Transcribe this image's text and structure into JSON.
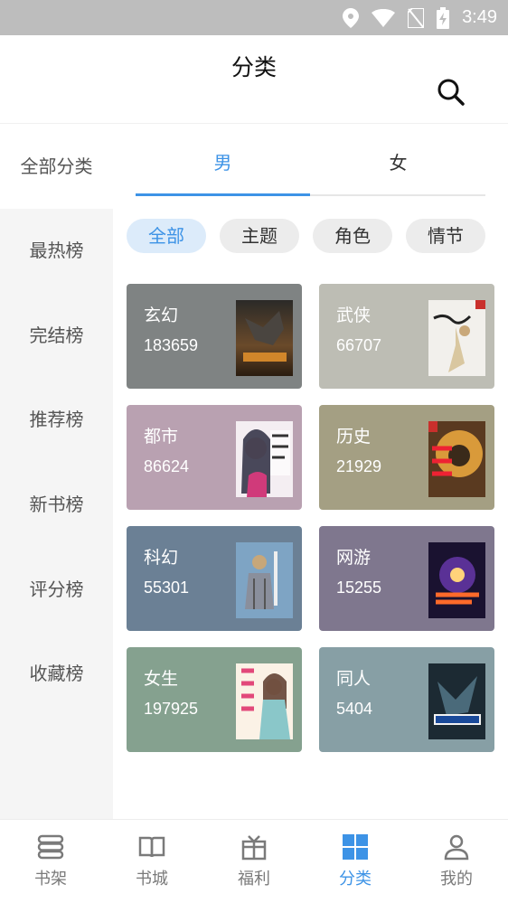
{
  "status_bar": {
    "time": "3:49"
  },
  "header": {
    "title": "分类",
    "search_icon": "search-icon"
  },
  "sidebar": {
    "items": [
      {
        "label": "全部分类",
        "selected": true
      },
      {
        "label": "最热榜"
      },
      {
        "label": "完结榜"
      },
      {
        "label": "推荐榜"
      },
      {
        "label": "新书榜"
      },
      {
        "label": "评分榜"
      },
      {
        "label": "收藏榜"
      }
    ]
  },
  "gender_tabs": [
    {
      "label": "男",
      "active": true
    },
    {
      "label": "女",
      "active": false
    }
  ],
  "filters": [
    {
      "label": "全部",
      "active": true
    },
    {
      "label": "主题"
    },
    {
      "label": "角色"
    },
    {
      "label": "情节"
    }
  ],
  "categories": [
    {
      "name": "玄幻",
      "count": "183659",
      "color": "#7f8383"
    },
    {
      "name": "武侠",
      "count": "66707",
      "color": "#bdbdb4"
    },
    {
      "name": "都市",
      "count": "86624",
      "color": "#b9a1b1"
    },
    {
      "name": "历史",
      "count": "21929",
      "color": "#a49f83"
    },
    {
      "name": "科幻",
      "count": "55301",
      "color": "#6b8095"
    },
    {
      "name": "网游",
      "count": "15255",
      "color": "#7f778e"
    },
    {
      "name": "女生",
      "count": "197925",
      "color": "#85a18f"
    },
    {
      "name": "同人",
      "count": "5404",
      "color": "#879fa5"
    }
  ],
  "bottom_nav": [
    {
      "label": "书架",
      "icon": "bookshelf-icon"
    },
    {
      "label": "书城",
      "icon": "book-icon"
    },
    {
      "label": "福利",
      "icon": "gift-icon"
    },
    {
      "label": "分类",
      "icon": "grid-icon",
      "active": true
    },
    {
      "label": "我的",
      "icon": "person-icon"
    }
  ],
  "colors": {
    "accent": "#3d93e6",
    "status_bar": "#bdbdbd",
    "sidebar_bg": "#f5f5f5"
  }
}
